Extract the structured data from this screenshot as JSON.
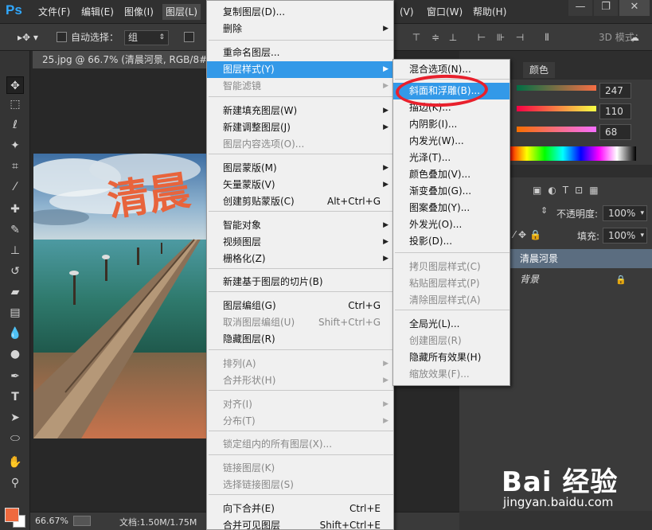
{
  "app": {
    "logo": "Ps"
  },
  "menubar": {
    "items": [
      "文件(F)",
      "编辑(E)",
      "图像(I)",
      "图层(L)",
      "(V)",
      "窗口(W)",
      "帮助(H)"
    ]
  },
  "options": {
    "auto_select_label": "自动选择：",
    "auto_select_value": "组",
    "mode_3d_label": "3D 模式："
  },
  "document": {
    "tab_title": "25.jpg @ 66.7% (清晨河景, RGB/8#)",
    "zoom": "66.67%",
    "doc_size": "文档:1.50M/1.75M",
    "photo_text": "清晨"
  },
  "colors_panel": {
    "tab": "颜色",
    "r": "247",
    "g": "110",
    "b": "68"
  },
  "layers_panel": {
    "opacity_label": "不透明度:",
    "opacity_value": "100%",
    "fill_label": "填充:",
    "fill_value": "100%",
    "layers": [
      {
        "name": "清晨河景"
      },
      {
        "name": "背景"
      }
    ]
  },
  "layer_menu": {
    "items": [
      {
        "label": "复制图层(D)...",
        "shortcut": "",
        "submenu": false,
        "disabled": false
      },
      {
        "label": "删除",
        "shortcut": "",
        "submenu": true,
        "disabled": false
      },
      {
        "label": "重命名图层...",
        "shortcut": "",
        "submenu": false,
        "disabled": false
      },
      {
        "label": "图层样式(Y)",
        "shortcut": "",
        "submenu": true,
        "disabled": false,
        "highlight": true
      },
      {
        "label": "智能滤镜",
        "shortcut": "",
        "submenu": true,
        "disabled": true
      },
      {
        "label": "新建填充图层(W)",
        "shortcut": "",
        "submenu": true,
        "disabled": false
      },
      {
        "label": "新建调整图层(J)",
        "shortcut": "",
        "submenu": true,
        "disabled": false
      },
      {
        "label": "图层内容选项(O)...",
        "shortcut": "",
        "submenu": false,
        "disabled": true
      },
      {
        "label": "图层蒙版(M)",
        "shortcut": "",
        "submenu": true,
        "disabled": false
      },
      {
        "label": "矢量蒙版(V)",
        "shortcut": "",
        "submenu": true,
        "disabled": false
      },
      {
        "label": "创建剪贴蒙版(C)",
        "shortcut": "Alt+Ctrl+G",
        "submenu": false,
        "disabled": false
      },
      {
        "label": "智能对象",
        "shortcut": "",
        "submenu": true,
        "disabled": false
      },
      {
        "label": "视频图层",
        "shortcut": "",
        "submenu": true,
        "disabled": false
      },
      {
        "label": "栅格化(Z)",
        "shortcut": "",
        "submenu": true,
        "disabled": false
      },
      {
        "label": "新建基于图层的切片(B)",
        "shortcut": "",
        "submenu": false,
        "disabled": false
      },
      {
        "label": "图层编组(G)",
        "shortcut": "Ctrl+G",
        "submenu": false,
        "disabled": false
      },
      {
        "label": "取消图层编组(U)",
        "shortcut": "Shift+Ctrl+G",
        "submenu": false,
        "disabled": true
      },
      {
        "label": "隐藏图层(R)",
        "shortcut": "",
        "submenu": false,
        "disabled": false
      },
      {
        "label": "排列(A)",
        "shortcut": "",
        "submenu": true,
        "disabled": true
      },
      {
        "label": "合并形状(H)",
        "shortcut": "",
        "submenu": true,
        "disabled": true
      },
      {
        "label": "对齐(I)",
        "shortcut": "",
        "submenu": true,
        "disabled": true
      },
      {
        "label": "分布(T)",
        "shortcut": "",
        "submenu": true,
        "disabled": true
      },
      {
        "label": "锁定组内的所有图层(X)...",
        "shortcut": "",
        "submenu": false,
        "disabled": true
      },
      {
        "label": "链接图层(K)",
        "shortcut": "",
        "submenu": false,
        "disabled": true
      },
      {
        "label": "选择链接图层(S)",
        "shortcut": "",
        "submenu": false,
        "disabled": true
      },
      {
        "label": "向下合并(E)",
        "shortcut": "Ctrl+E",
        "submenu": false,
        "disabled": false
      },
      {
        "label": "合并可见图层",
        "shortcut": "Shift+Ctrl+E",
        "submenu": false,
        "disabled": false
      }
    ]
  },
  "style_submenu": {
    "items": [
      {
        "label": "混合选项(N)...",
        "disabled": false
      },
      {
        "label": "斜面和浮雕(B)...",
        "disabled": false,
        "highlight": true
      },
      {
        "label": "描边(K)...",
        "disabled": false
      },
      {
        "label": "内阴影(I)...",
        "disabled": false
      },
      {
        "label": "内发光(W)...",
        "disabled": false
      },
      {
        "label": "光泽(T)...",
        "disabled": false
      },
      {
        "label": "颜色叠加(V)...",
        "disabled": false
      },
      {
        "label": "渐变叠加(G)...",
        "disabled": false
      },
      {
        "label": "图案叠加(Y)...",
        "disabled": false
      },
      {
        "label": "外发光(O)...",
        "disabled": false
      },
      {
        "label": "投影(D)...",
        "disabled": false
      },
      {
        "label": "拷贝图层样式(C)",
        "disabled": true
      },
      {
        "label": "粘贴图层样式(P)",
        "disabled": true
      },
      {
        "label": "清除图层样式(A)",
        "disabled": true
      },
      {
        "label": "全局光(L)...",
        "disabled": false
      },
      {
        "label": "创建图层(R)",
        "disabled": true
      },
      {
        "label": "隐藏所有效果(H)",
        "disabled": false
      },
      {
        "label": "缩放效果(F)...",
        "disabled": true
      }
    ]
  },
  "watermark": {
    "logo": "Bai 经验",
    "url": "jingyan.baidu.com"
  },
  "accent": "#3399e8"
}
